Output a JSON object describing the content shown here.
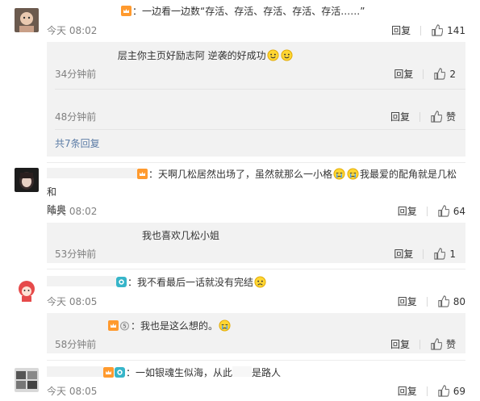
{
  "icons": {
    "like": "thumbs-up-icon",
    "crown": "crown-badge-icon",
    "vip": "vip-badge-icon",
    "medal": "medal-badge-icon"
  },
  "colors": {
    "link": "#5c7ca6",
    "meta": "#808080",
    "reply_bg": "#f2f2f2"
  },
  "reply_label": "回复",
  "like_label": "赞",
  "comments": [
    {
      "text": "：一边看一边数“存活、存活、存活、存活、存活……”",
      "time": "今天 08:02",
      "likes": "141",
      "replies": [
        {
          "text": "层主你主页好励志阿 逆袭的好成功",
          "time": "34分钟前",
          "likes": "2"
        },
        {
          "time": "48分钟前"
        }
      ],
      "more_replies": "共7条回复"
    },
    {
      "text_line1": "：天啊几松居然出场了，虽然就那么一小格",
      "text_line1b": "我最爱的配角就是几松和",
      "text_line2": "陆奥",
      "time": "今天 08:02",
      "likes": "64",
      "replies": [
        {
          "text": "我也喜欢几松小姐",
          "time": "53分钟前",
          "likes": "1"
        }
      ]
    },
    {
      "text": "：我不看最后一话就没有完结",
      "time": "今天 08:05",
      "likes": "80",
      "replies": [
        {
          "text": "：我也是这么想的。",
          "time": "58分钟前"
        }
      ]
    },
    {
      "text_a": "：一如银魂生似海，从此",
      "text_b": "是路人",
      "time": "今天 08:05",
      "likes": "69"
    }
  ]
}
